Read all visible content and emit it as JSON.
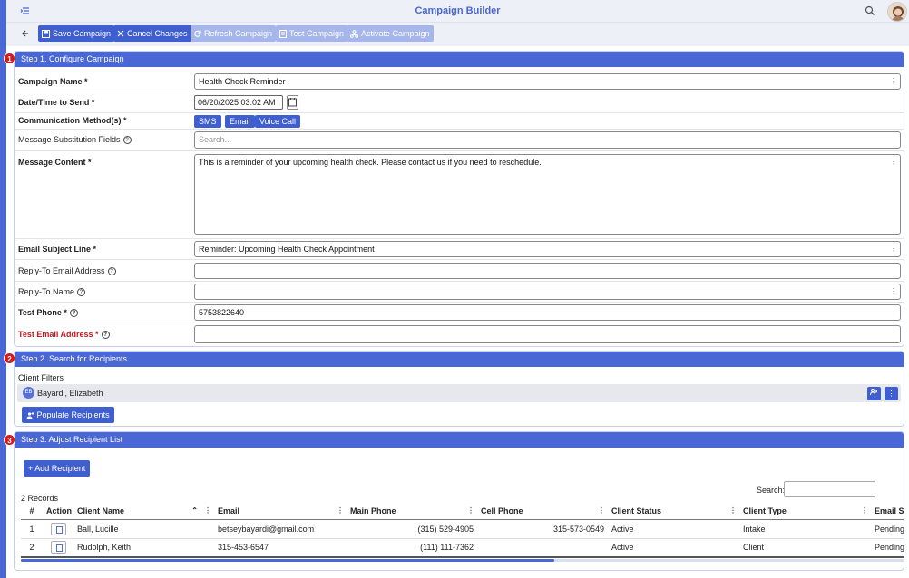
{
  "app": {
    "title": "Campaign Builder"
  },
  "toolbar": {
    "save": "Save Campaign",
    "cancel": "Cancel Changes",
    "refresh": "Refresh Campaign",
    "test": "Test Campaign",
    "activate": "Activate Campaign"
  },
  "steps": {
    "s1": {
      "num": "1",
      "title": "Step 1. Configure Campaign"
    },
    "s2": {
      "num": "2",
      "title": "Step 2. Search for Recipients"
    },
    "s3": {
      "num": "3",
      "title": "Step 3. Adjust Recipient List"
    }
  },
  "form": {
    "campaign_name": {
      "label": "Campaign Name *",
      "value": "Health Check Reminder"
    },
    "datetime": {
      "label": "Date/Time to Send *",
      "value": "06/20/2025 03:02 AM"
    },
    "method": {
      "label": "Communication Method(s) *",
      "options": [
        "SMS",
        "Email",
        "Voice Call"
      ]
    },
    "subst": {
      "label": "Message Substitution Fields",
      "placeholder": "Search..."
    },
    "content": {
      "label": "Message Content *",
      "value": "This is a reminder of your upcoming health check. Please contact us if you need to reschedule."
    },
    "subject": {
      "label": "Email Subject Line *",
      "value": "Reminder: Upcoming Health Check Appointment"
    },
    "reply_email": {
      "label": "Reply-To Email Address",
      "value": ""
    },
    "reply_name": {
      "label": "Reply-To Name",
      "value": ""
    },
    "test_phone": {
      "label": "Test Phone *",
      "value": "5753822640"
    },
    "test_email": {
      "label": "Test Email Address *",
      "value": ""
    }
  },
  "recipients_search": {
    "filters_label": "Client Filters",
    "chip": {
      "initials": "EB",
      "name": "Bayardi, Elizabeth"
    },
    "populate": "Populate Recipients"
  },
  "recipient_list": {
    "add": "+ Add Recipient",
    "records": "2 Records",
    "search_label": "Search:",
    "columns": [
      "#",
      "Action",
      "Client Name",
      "Email",
      "Main Phone",
      "Cell Phone",
      "Client Status",
      "Client Type",
      "Email Sta"
    ],
    "rows": [
      {
        "n": "1",
        "name": "Ball, Lucille",
        "email": "betseybayardi@gmail.com",
        "main": "(315) 529-4905",
        "cell": "315-573-0549",
        "status": "Active",
        "type": "Intake",
        "estatus": "Pending"
      },
      {
        "n": "2",
        "name": "Rudolph, Keith",
        "email": "315-453-6547",
        "main": "(111) 111-7362",
        "cell": "",
        "status": "Active",
        "type": "Client",
        "estatus": "Pending"
      }
    ]
  },
  "colors": {
    "primary": "#3f5ecf",
    "header": "#4a67d6",
    "disabled": "#a7b6ea",
    "step_badge": "#d31b1b",
    "required_red": "#c0171e"
  },
  "icons": [
    "menu-icon",
    "search-icon",
    "avatar",
    "back-arrow-icon",
    "save-icon",
    "close-icon",
    "refresh-icon",
    "document-icon",
    "network-icon",
    "calendar-icon",
    "help-icon",
    "kebab-icon",
    "user-add-icon",
    "sort-icon",
    "view-icon"
  ]
}
